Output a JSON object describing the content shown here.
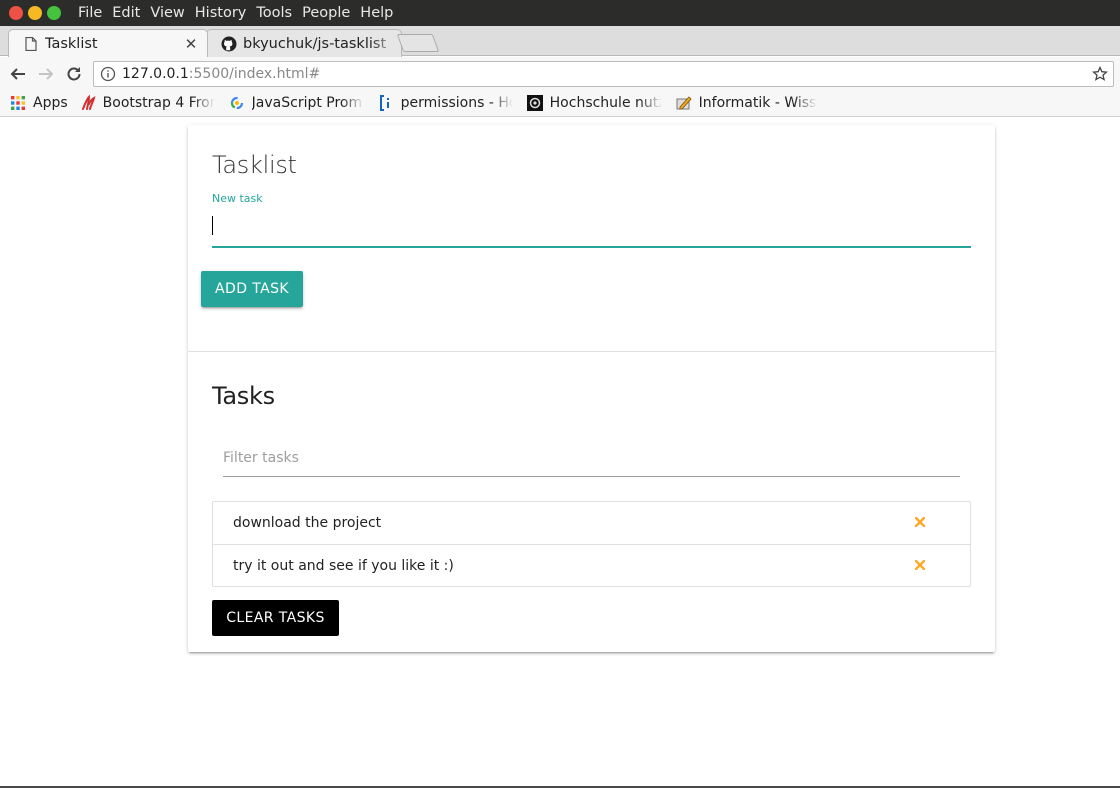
{
  "os_menu": [
    "File",
    "Edit",
    "View",
    "History",
    "Tools",
    "People",
    "Help"
  ],
  "tabs": [
    {
      "title": "Tasklist",
      "close": "✕",
      "icon": "page-icon"
    },
    {
      "title": "bkyuchuk/js-tasklist",
      "close": "",
      "icon": "github-icon"
    }
  ],
  "address": {
    "host": "127.0.0.1",
    "rest": ":5500/index.html#"
  },
  "bookmarks": [
    {
      "label": "Apps",
      "icon": "apps-grid-icon"
    },
    {
      "label": "Bootstrap 4 Fron",
      "icon": "bootstrap-icon"
    },
    {
      "label": "JavaScript Prom",
      "icon": "google-icon"
    },
    {
      "label": "permissions - Ho",
      "icon": "bracket-icon"
    },
    {
      "label": "Hochschule nutz",
      "icon": "hochschule-icon"
    },
    {
      "label": "Informatik - Wiss",
      "icon": "informatik-icon"
    }
  ],
  "page": {
    "title": "Tasklist",
    "new_task_label": "New task",
    "new_task_value": "",
    "add_button": "ADD TASK",
    "tasks_title": "Tasks",
    "filter_placeholder": "Filter tasks",
    "tasks": [
      {
        "text": "download the project"
      },
      {
        "text": "try it out and see if you like it :)"
      }
    ],
    "clear_button": "CLEAR TASKS"
  },
  "colors": {
    "accent": "#26a69a",
    "delete": "#ffa726"
  }
}
